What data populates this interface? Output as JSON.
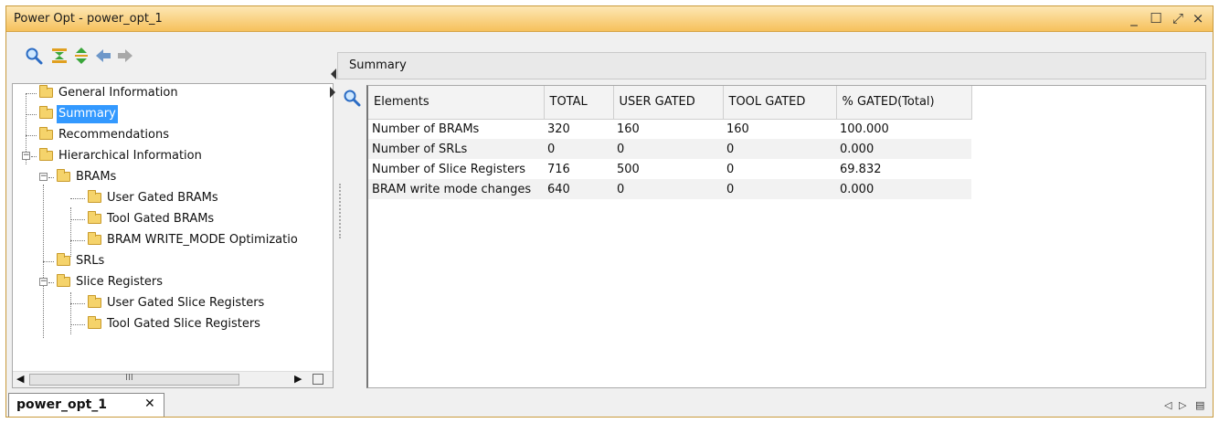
{
  "window": {
    "title": "Power Opt - power_opt_1",
    "min_glyph": "_",
    "max_glyph": "☐",
    "restore_glyph": "⤢",
    "close_glyph": "×"
  },
  "toolbar": {
    "icons": [
      "search-icon",
      "collapse-all-icon",
      "expand-all-icon",
      "back-arrow-icon",
      "forward-arrow-icon"
    ]
  },
  "tree": {
    "items": [
      {
        "label": "General Information"
      },
      {
        "label": "Summary",
        "selected": true
      },
      {
        "label": "Recommendations"
      },
      {
        "label": "Hierarchical Information"
      },
      {
        "label": "BRAMs"
      },
      {
        "label": "User Gated BRAMs"
      },
      {
        "label": "Tool Gated BRAMs"
      },
      {
        "label": "BRAM WRITE_MODE Optimizatio"
      },
      {
        "label": "SRLs"
      },
      {
        "label": "Slice Registers"
      },
      {
        "label": "User Gated Slice Registers"
      },
      {
        "label": "Tool Gated Slice Registers"
      }
    ],
    "scroll_grip": "III"
  },
  "summary": {
    "header": "Summary",
    "columns": [
      "Elements",
      "TOTAL",
      "USER GATED",
      "TOOL GATED",
      "% GATED(Total)"
    ],
    "rows": [
      [
        "Number of BRAMs",
        "320",
        "160",
        "160",
        "100.000"
      ],
      [
        "Number of SRLs",
        "0",
        "0",
        "0",
        "0.000"
      ],
      [
        "Number of Slice Registers",
        "716",
        "500",
        "0",
        "69.832"
      ],
      [
        "BRAM write mode changes",
        "640",
        "0",
        "0",
        "0.000"
      ]
    ]
  },
  "bottom": {
    "tab_label": "power_opt_1",
    "tab_close": "✕",
    "nav_left": "◁",
    "nav_right": "▷",
    "nav_menu": "▤"
  },
  "colors": {
    "title_bar": "#f6c15c",
    "selection": "#3399ff",
    "folder": "#f5d36b"
  }
}
